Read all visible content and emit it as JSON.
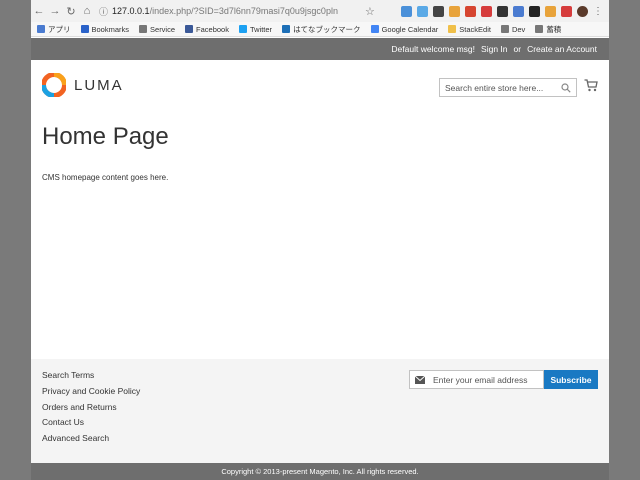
{
  "browser": {
    "url_host": "127.0.0.1",
    "url_path": "/index.php/?SID=3d7l6nn79masi7q0u9jsgc0pln",
    "bookmarks": [
      {
        "label": "アプリ",
        "color": "#4a7bd0"
      },
      {
        "label": "Bookmarks",
        "color": "#2a62c9"
      },
      {
        "label": "Service",
        "color": "#777777"
      },
      {
        "label": "Facebook",
        "color": "#3b5998"
      },
      {
        "label": "Twitter",
        "color": "#1da1f2"
      },
      {
        "label": "はてなブックマーク",
        "color": "#1d6fb7"
      },
      {
        "label": "Google Calendar",
        "color": "#4285f4"
      },
      {
        "label": "StackEdit",
        "color": "#f0c04a"
      },
      {
        "label": "Dev",
        "color": "#777777"
      },
      {
        "label": "蓄積",
        "color": "#777777"
      }
    ]
  },
  "header_panel": {
    "welcome": "Default welcome msg!",
    "sign_in": "Sign In",
    "or": "or",
    "create_account": "Create an Account"
  },
  "header": {
    "logo_text": "LUMA",
    "search_placeholder": "Search entire store here..."
  },
  "main": {
    "title": "Home Page",
    "content": "CMS homepage content goes here."
  },
  "footer": {
    "links": [
      "Search Terms",
      "Privacy and Cookie Policy",
      "Orders and Returns",
      "Contact Us",
      "Advanced Search"
    ],
    "newsletter_placeholder": "Enter your email address",
    "subscribe_label": "Subscribe",
    "copyright": "Copyright © 2013-present Magento, Inc. All rights reserved."
  },
  "colors": {
    "accent": "#1979c3",
    "panel": "#6e6e6e",
    "logo_orange": "#f26322"
  },
  "icons": {
    "back": "back-arrow-icon",
    "forward": "forward-arrow-icon",
    "reload": "reload-icon",
    "home": "home-icon",
    "search": "magnifier-icon",
    "cart": "cart-icon",
    "email": "envelope-icon"
  }
}
